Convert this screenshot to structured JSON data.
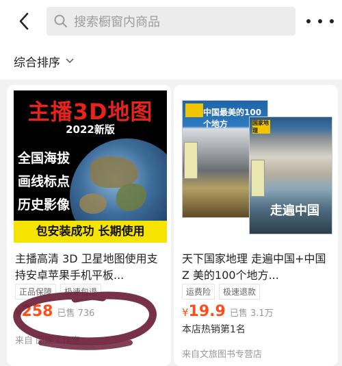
{
  "header": {
    "back_icon": "chevron-left-icon",
    "search_icon": "search-icon",
    "search_placeholder": "搜索橱窗内商品",
    "more_icon": "more-horizontal-icon"
  },
  "sort": {
    "label": "综合排序",
    "chevron_icon": "chevron-down-icon"
  },
  "products": [
    {
      "image": {
        "banner": "主播3D地图",
        "year": "2022新版",
        "features": [
          "全国海拔",
          "画线标点",
          "历史影像"
        ],
        "bottom": "包安装成功 长期使用"
      },
      "title": "主播高清 3D 卫星地图使用支持安卓苹果手机平板...",
      "tags": [
        "正品保障",
        "极速包退"
      ],
      "currency": "¥",
      "price": "258",
      "sold": "已售 736",
      "shop": "来自 图娱工作室"
    },
    {
      "image": {
        "brand": "国家地理",
        "back_title": "中国最美的100个地方",
        "front_title": "走遍中国"
      },
      "title": "天下国家地理 走遍中国+中国 Z 美的100个地方...",
      "tags": [
        "运费险",
        "极速退款"
      ],
      "currency": "¥",
      "price": "19.9",
      "sold": "已售 3.1万",
      "rank": "本店热销第1名",
      "shop": "来自文旅图书专营店"
    }
  ],
  "colors": {
    "price": "#ff4d1a",
    "background": "#f2f2f2",
    "scribble": "#6b1f3a"
  }
}
